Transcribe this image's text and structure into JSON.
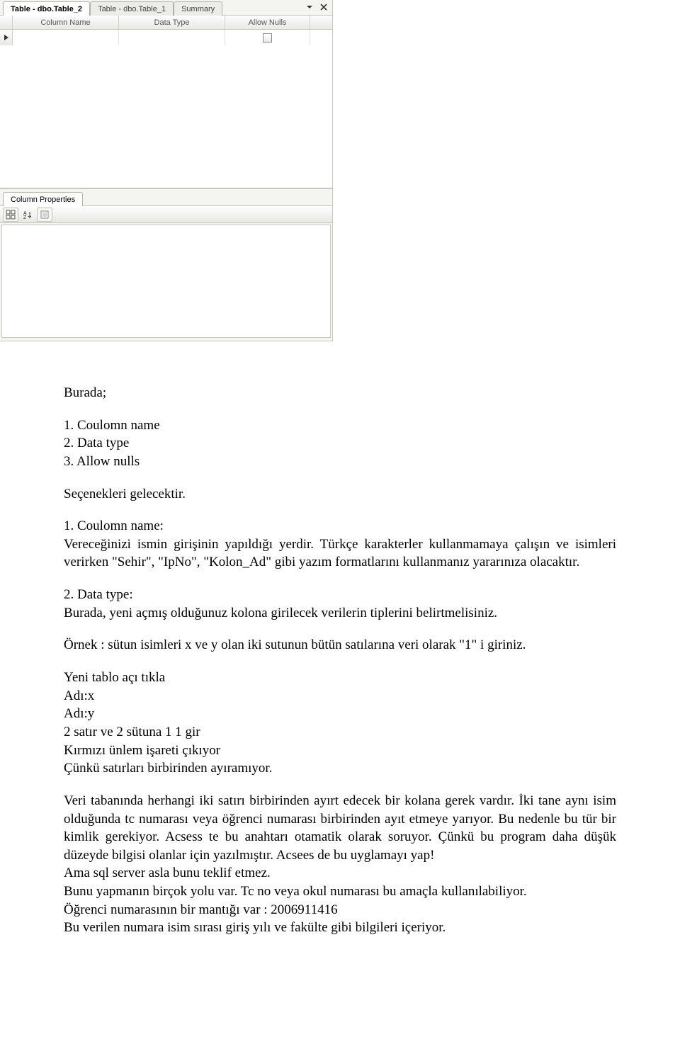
{
  "ssms": {
    "tabs": [
      {
        "label": "Table - dbo.Table_2",
        "active": true
      },
      {
        "label": "Table - dbo.Table_1",
        "active": false
      },
      {
        "label": "Summary",
        "active": false
      }
    ],
    "headers": {
      "col1": "Column Name",
      "col2": "Data Type",
      "col3": "Allow Nulls"
    },
    "row1": {
      "col1": "",
      "col2": "",
      "allowNulls": false
    },
    "propsTab": "Column Properties"
  },
  "article": {
    "p_burada": "Burada;",
    "p_list1": "1. Coulomn name",
    "p_list2": "2. Data type",
    "p_list3": "3. Allow nulls",
    "p_secenek": "Seçenekleri gelecektir.",
    "p_h1": "1. Coulomn name:",
    "p_h1_body1": "Vereceğinizi ismin girişinin yapıldığı yerdir. Türkçe karakterler kullanmamaya çalışın ve isimleri verirken \"Sehir\", \"IpNo\", \"Kolon_Ad\" gibi yazım formatlarını kullanmanız yararınıza olacaktır.",
    "p_h2": "2. Data type:",
    "p_h2_body": "Burada, yeni açmış olduğunuz kolona girilecek verilerin tiplerini belirtmelisiniz.",
    "p_ornek": "Örnek : sütun isimleri x ve y olan iki sutunun bütün satılarına veri olarak \"1\" i giriniz.",
    "p_yenitablo": "Yeni tablo açı tıkla",
    "p_adix": "Adı:x",
    "p_adiy": "Adı:y",
    "p_satir": "2 satır ve 2 sütuna 1 1 gir",
    "p_kirmizi": "Kırmızı ünlem işareti çıkıyor",
    "p_cunku": "Çünkü satırları birbirinden ayıramıyor.",
    "p_big": "Veri tabanında herhangi iki satırı birbirinden ayırt edecek bir kolana gerek vardır. İki tane aynı isim olduğunda tc numarası veya öğrenci numarası birbirinden ayıt etmeye yarıyor. Bu nedenle bu tür bir kimlik gerekiyor. Acsess te bu anahtarı otamatik olarak soruyor. Çünkü bu program daha düşük düzeyde bilgisi olanlar için yazılmıştır. Acsees de bu uyglamayı yap!",
    "p_ama": "Ama sql server asla bunu teklif etmez.",
    "p_bunu": "Bunu yapmanın birçok yolu var. Tc no veya okul numarası bu amaçla kullanılabiliyor.",
    "p_ogrenci": "Öğrenci numarasının bir mantığı var : 2006911416",
    "p_buverilen": "Bu verilen numara isim sırası giriş yılı ve fakülte gibi bilgileri içeriyor."
  }
}
